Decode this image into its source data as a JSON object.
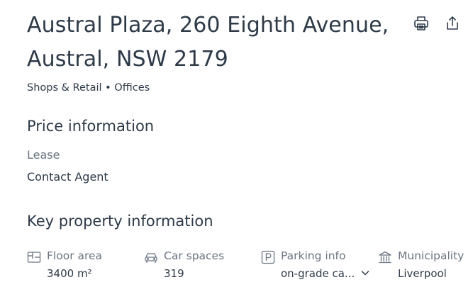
{
  "header": {
    "title_line1": "Austral Plaza, 260 Eighth Avenue,",
    "title_line2": "Austral, NSW 2179",
    "subtitle": "Shops & Retail • Offices",
    "actions": {
      "print_icon": "printer-icon",
      "share_icon": "share-icon"
    }
  },
  "price": {
    "heading": "Price information",
    "lease_label": "Lease",
    "lease_value": "Contact Agent"
  },
  "key_info": {
    "heading": "Key property information",
    "items": [
      {
        "icon": "floor-area-icon",
        "label": "Floor area",
        "value": "3400 m²"
      },
      {
        "icon": "car-icon",
        "label": "Car spaces",
        "value": "319"
      },
      {
        "icon": "parking-icon",
        "label": "Parking info",
        "value": "on-grade ca..."
      },
      {
        "icon": "municipality-icon",
        "label": "Municipality",
        "value": "Liverpool"
      }
    ]
  }
}
